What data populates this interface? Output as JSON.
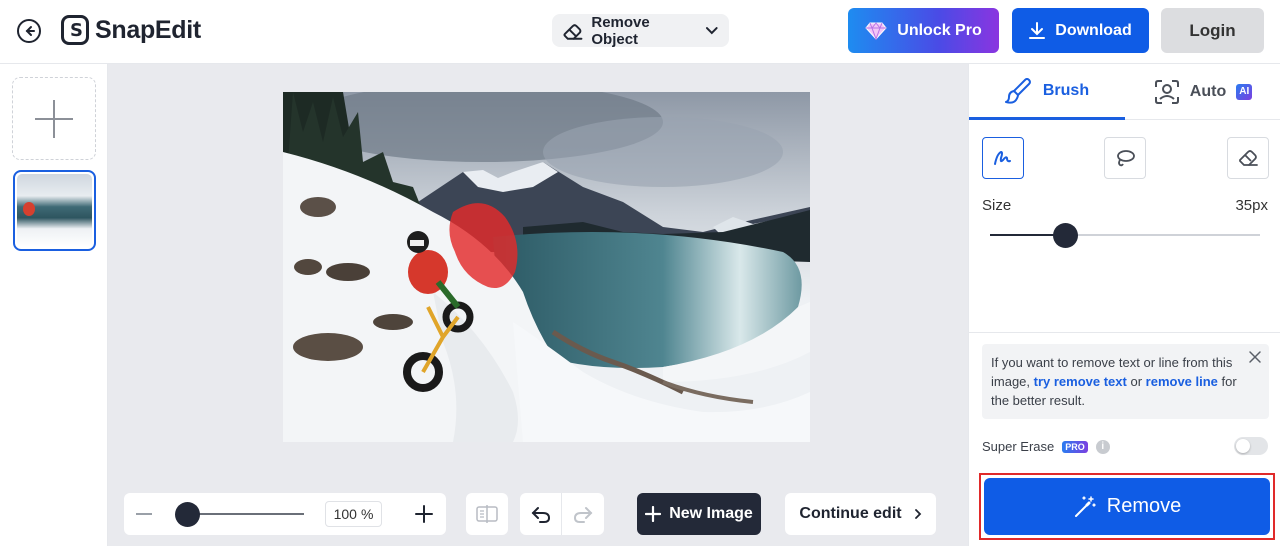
{
  "header": {
    "logo_text": "SnapEdit",
    "mode_label": "Remove Object",
    "unlock_pro_label": "Unlock Pro",
    "download_label": "Download",
    "login_label": "Login"
  },
  "toolbar": {
    "zoom_value": "100",
    "zoom_unit": "%",
    "new_image_label": "New Image",
    "continue_edit_label": "Continue edit"
  },
  "panel": {
    "tabs": [
      {
        "label": "Brush",
        "active": true
      },
      {
        "label": "Auto",
        "badge": "AI",
        "active": false
      }
    ],
    "size_label": "Size",
    "size_value": "35px",
    "tip": {
      "text_before": "If you want to remove text or line from this image, ",
      "link1": "try remove text",
      "text_middle": " or ",
      "link2": "remove line",
      "text_after": " for the better result."
    },
    "super_erase_label": "Super Erase",
    "super_erase_badge": "PRO",
    "info_glyph": "i",
    "super_erase_enabled": false,
    "remove_label": "Remove"
  },
  "colors": {
    "accent": "#1a5fe0",
    "primary_button": "#0f5ce6",
    "dark_button": "#232938",
    "highlight_border": "#e02a2a",
    "mask": "#e32b2b"
  }
}
